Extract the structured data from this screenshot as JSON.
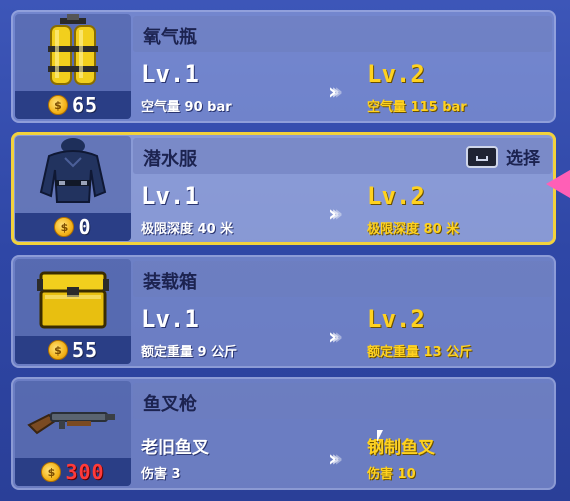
{
  "items": [
    {
      "name": "氧气瓶",
      "price": "65",
      "price_red": false,
      "current": "Lv.1",
      "next": "Lv.2",
      "current_stat": "空气量 90 bar",
      "next_stat": "空气量 115 bar",
      "selected": false
    },
    {
      "name": "潜水服",
      "price": "0",
      "price_red": false,
      "current": "Lv.1",
      "next": "Lv.2",
      "current_stat": "极限深度 40 米",
      "next_stat": "极限深度 80 米",
      "selected": true,
      "select_label": "选择"
    },
    {
      "name": "装载箱",
      "price": "55",
      "price_red": false,
      "current": "Lv.1",
      "next": "Lv.2",
      "current_stat": "额定重量 9 公斤",
      "next_stat": "额定重量 13 公斤",
      "selected": false
    },
    {
      "name": "鱼叉枪",
      "price": "300",
      "price_red": true,
      "current": "老旧鱼叉",
      "next": "钢制鱼叉",
      "current_stat": "伤害 3",
      "next_stat": "伤害 10",
      "selected": false
    }
  ],
  "coin_symbol": "$",
  "colors": {
    "selected_border": "#f2d23c",
    "next_level": "#ffd21f",
    "price_red": "#ff3a3a",
    "pointer": "#ff5fb6"
  }
}
